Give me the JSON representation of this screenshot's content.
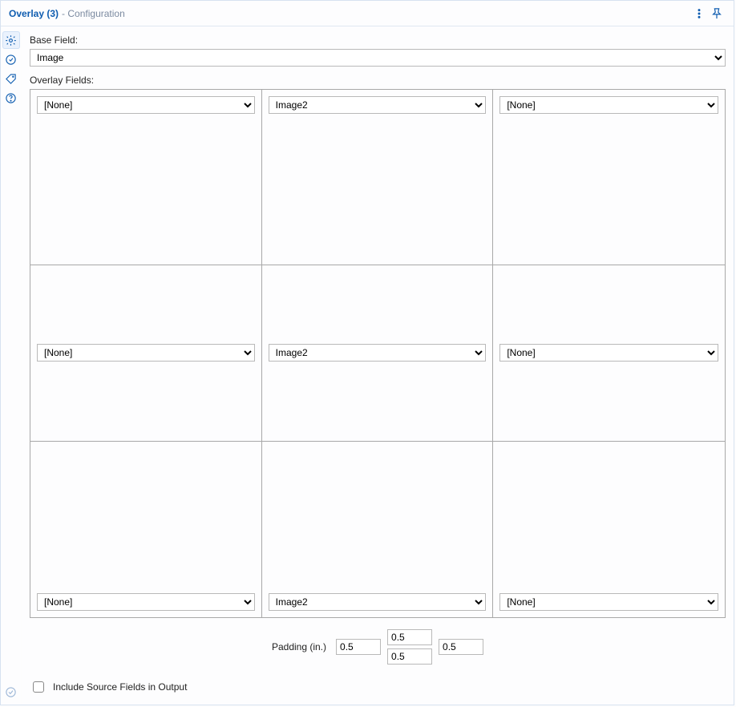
{
  "title": {
    "main": "Overlay (3)",
    "sub": "- Configuration"
  },
  "labels": {
    "base_field": "Base Field:",
    "overlay_fields": "Overlay Fields:",
    "padding": "Padding (in.)",
    "include_source": "Include Source Fields in Output"
  },
  "base_field_value": "Image",
  "base_field_options": [
    "Image"
  ],
  "overlay_options": [
    "[None]",
    "Image2"
  ],
  "overlay_grid": [
    [
      "[None]",
      "Image2",
      "[None]"
    ],
    [
      "[None]",
      "Image2",
      "[None]"
    ],
    [
      "[None]",
      "Image2",
      "[None]"
    ]
  ],
  "padding": {
    "left": "0.5",
    "top": "0.5",
    "bottom": "0.5",
    "right": "0.5"
  },
  "include_source_checked": false
}
